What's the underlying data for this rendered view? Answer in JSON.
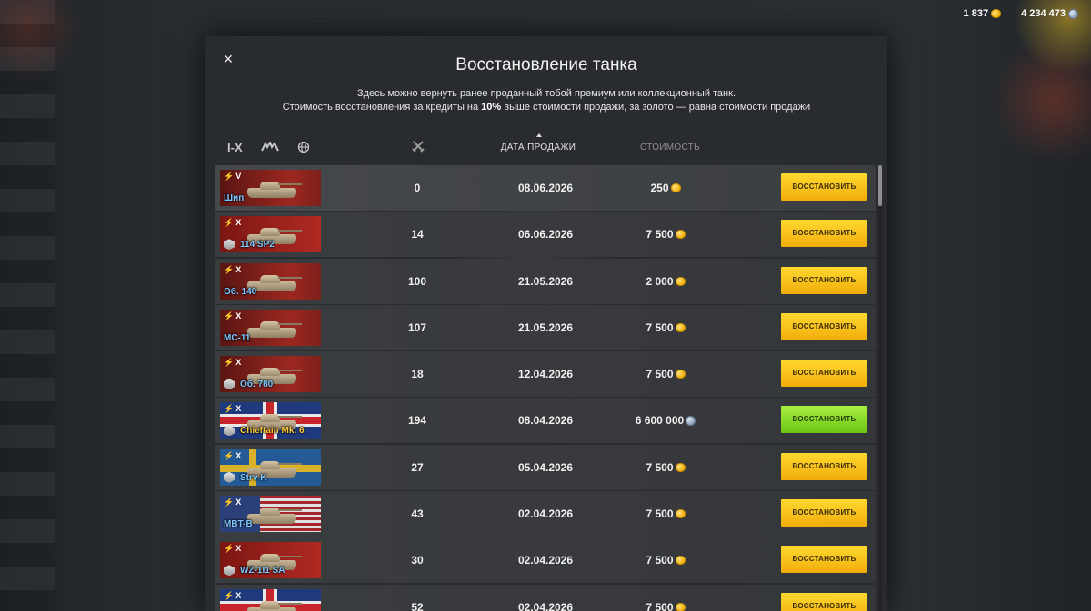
{
  "currency": {
    "gold": "1 837",
    "credits": "4 234 473"
  },
  "modal": {
    "title": "Восстановление танка",
    "desc_line1": "Здесь можно вернуть ранее проданный тобой премиум или коллекционный танк.",
    "desc_line2_pre": "Стоимость восстановления за кредиты на ",
    "desc_line2_bold": "10%",
    "desc_line2_post": " выше стоимости продажи, за золото — равна стоимости продажи",
    "close_label": "×"
  },
  "filters": {
    "tier_label": "I-X"
  },
  "columns": {
    "date": "ДАТА ПРОДАЖИ",
    "cost": "СТОИМОСТЬ"
  },
  "rows": [
    {
      "tier": "V",
      "name": "Шип",
      "battles": "0",
      "date": "08.06.2026",
      "cost": "250",
      "currency": "gold",
      "button": "ВОССТАНОВИТЬ",
      "nation": "ussr",
      "premium_badge": false,
      "collectible": false
    },
    {
      "tier": "X",
      "name": "114 SP2",
      "battles": "14",
      "date": "06.06.2026",
      "cost": "7 500",
      "currency": "gold",
      "button": "ВОССТАНОВИТЬ",
      "nation": "chn",
      "premium_badge": true,
      "collectible": false
    },
    {
      "tier": "X",
      "name": "Об. 140",
      "battles": "100",
      "date": "21.05.2026",
      "cost": "2 000",
      "currency": "gold",
      "button": "ВОССТАНОВИТЬ",
      "nation": "ussr",
      "premium_badge": false,
      "collectible": false
    },
    {
      "tier": "X",
      "name": "МС-11",
      "battles": "107",
      "date": "21.05.2026",
      "cost": "7 500",
      "currency": "gold",
      "button": "ВОССТАНОВИТЬ",
      "nation": "ussr",
      "premium_badge": false,
      "collectible": false
    },
    {
      "tier": "X",
      "name": "Об. 780",
      "battles": "18",
      "date": "12.04.2026",
      "cost": "7 500",
      "currency": "gold",
      "button": "ВОССТАНОВИТЬ",
      "nation": "ussr",
      "premium_badge": true,
      "collectible": false
    },
    {
      "tier": "X",
      "name": "Chieftain Mk. 6",
      "battles": "194",
      "date": "08.04.2026",
      "cost": "6 600 000",
      "currency": "credits",
      "button": "ВОССТАНОВИТЬ",
      "nation": "gbr",
      "premium_badge": true,
      "collectible": true
    },
    {
      "tier": "X",
      "name": "Strv K",
      "battles": "27",
      "date": "05.04.2026",
      "cost": "7 500",
      "currency": "gold",
      "button": "ВОССТАНОВИТЬ",
      "nation": "swe",
      "premium_badge": true,
      "collectible": false
    },
    {
      "tier": "X",
      "name": "MBT-B",
      "battles": "43",
      "date": "02.04.2026",
      "cost": "7 500",
      "currency": "gold",
      "button": "ВОССТАНОВИТЬ",
      "nation": "usa",
      "premium_badge": false,
      "collectible": false
    },
    {
      "tier": "X",
      "name": "WZ-1I1 SA",
      "battles": "30",
      "date": "02.04.2026",
      "cost": "7 500",
      "currency": "gold",
      "button": "ВОССТАНОВИТЬ",
      "nation": "chn",
      "premium_badge": true,
      "collectible": false
    },
    {
      "tier": "X",
      "name": "",
      "battles": "52",
      "date": "02.04.2026",
      "cost": "7 500",
      "currency": "gold",
      "button": "ВОССТАНОВИТЬ",
      "nation": "gbr",
      "premium_badge": false,
      "collectible": false
    }
  ],
  "colors": {
    "gold_button": "#f2ac0a",
    "green_button": "#6cc414",
    "premium_name": "#7ec6ff",
    "collectible_name": "#ffc93c"
  }
}
